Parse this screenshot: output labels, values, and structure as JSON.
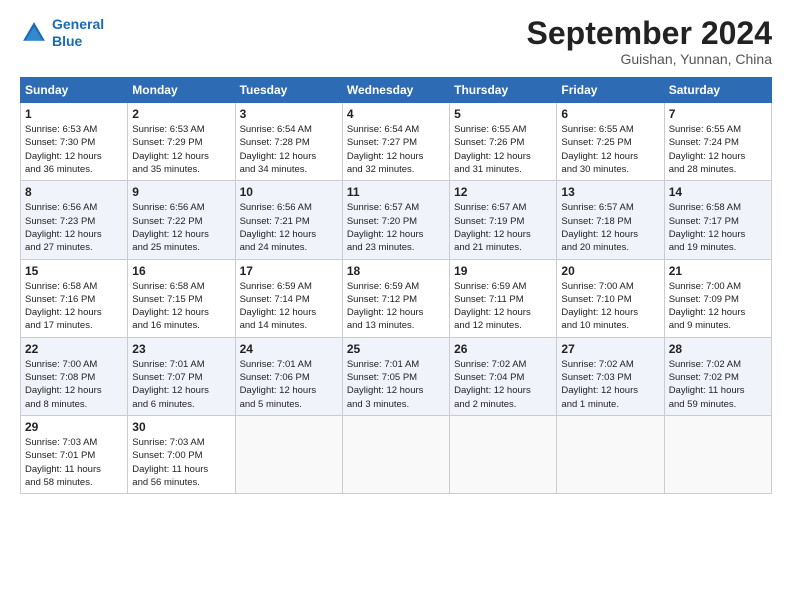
{
  "header": {
    "logo_line1": "General",
    "logo_line2": "Blue",
    "month_title": "September 2024",
    "location": "Guishan, Yunnan, China"
  },
  "weekdays": [
    "Sunday",
    "Monday",
    "Tuesday",
    "Wednesday",
    "Thursday",
    "Friday",
    "Saturday"
  ],
  "weeks": [
    [
      {
        "day": "1",
        "text": "Sunrise: 6:53 AM\nSunset: 7:30 PM\nDaylight: 12 hours\nand 36 minutes."
      },
      {
        "day": "2",
        "text": "Sunrise: 6:53 AM\nSunset: 7:29 PM\nDaylight: 12 hours\nand 35 minutes."
      },
      {
        "day": "3",
        "text": "Sunrise: 6:54 AM\nSunset: 7:28 PM\nDaylight: 12 hours\nand 34 minutes."
      },
      {
        "day": "4",
        "text": "Sunrise: 6:54 AM\nSunset: 7:27 PM\nDaylight: 12 hours\nand 32 minutes."
      },
      {
        "day": "5",
        "text": "Sunrise: 6:55 AM\nSunset: 7:26 PM\nDaylight: 12 hours\nand 31 minutes."
      },
      {
        "day": "6",
        "text": "Sunrise: 6:55 AM\nSunset: 7:25 PM\nDaylight: 12 hours\nand 30 minutes."
      },
      {
        "day": "7",
        "text": "Sunrise: 6:55 AM\nSunset: 7:24 PM\nDaylight: 12 hours\nand 28 minutes."
      }
    ],
    [
      {
        "day": "8",
        "text": "Sunrise: 6:56 AM\nSunset: 7:23 PM\nDaylight: 12 hours\nand 27 minutes."
      },
      {
        "day": "9",
        "text": "Sunrise: 6:56 AM\nSunset: 7:22 PM\nDaylight: 12 hours\nand 25 minutes."
      },
      {
        "day": "10",
        "text": "Sunrise: 6:56 AM\nSunset: 7:21 PM\nDaylight: 12 hours\nand 24 minutes."
      },
      {
        "day": "11",
        "text": "Sunrise: 6:57 AM\nSunset: 7:20 PM\nDaylight: 12 hours\nand 23 minutes."
      },
      {
        "day": "12",
        "text": "Sunrise: 6:57 AM\nSunset: 7:19 PM\nDaylight: 12 hours\nand 21 minutes."
      },
      {
        "day": "13",
        "text": "Sunrise: 6:57 AM\nSunset: 7:18 PM\nDaylight: 12 hours\nand 20 minutes."
      },
      {
        "day": "14",
        "text": "Sunrise: 6:58 AM\nSunset: 7:17 PM\nDaylight: 12 hours\nand 19 minutes."
      }
    ],
    [
      {
        "day": "15",
        "text": "Sunrise: 6:58 AM\nSunset: 7:16 PM\nDaylight: 12 hours\nand 17 minutes."
      },
      {
        "day": "16",
        "text": "Sunrise: 6:58 AM\nSunset: 7:15 PM\nDaylight: 12 hours\nand 16 minutes."
      },
      {
        "day": "17",
        "text": "Sunrise: 6:59 AM\nSunset: 7:14 PM\nDaylight: 12 hours\nand 14 minutes."
      },
      {
        "day": "18",
        "text": "Sunrise: 6:59 AM\nSunset: 7:12 PM\nDaylight: 12 hours\nand 13 minutes."
      },
      {
        "day": "19",
        "text": "Sunrise: 6:59 AM\nSunset: 7:11 PM\nDaylight: 12 hours\nand 12 minutes."
      },
      {
        "day": "20",
        "text": "Sunrise: 7:00 AM\nSunset: 7:10 PM\nDaylight: 12 hours\nand 10 minutes."
      },
      {
        "day": "21",
        "text": "Sunrise: 7:00 AM\nSunset: 7:09 PM\nDaylight: 12 hours\nand 9 minutes."
      }
    ],
    [
      {
        "day": "22",
        "text": "Sunrise: 7:00 AM\nSunset: 7:08 PM\nDaylight: 12 hours\nand 8 minutes."
      },
      {
        "day": "23",
        "text": "Sunrise: 7:01 AM\nSunset: 7:07 PM\nDaylight: 12 hours\nand 6 minutes."
      },
      {
        "day": "24",
        "text": "Sunrise: 7:01 AM\nSunset: 7:06 PM\nDaylight: 12 hours\nand 5 minutes."
      },
      {
        "day": "25",
        "text": "Sunrise: 7:01 AM\nSunset: 7:05 PM\nDaylight: 12 hours\nand 3 minutes."
      },
      {
        "day": "26",
        "text": "Sunrise: 7:02 AM\nSunset: 7:04 PM\nDaylight: 12 hours\nand 2 minutes."
      },
      {
        "day": "27",
        "text": "Sunrise: 7:02 AM\nSunset: 7:03 PM\nDaylight: 12 hours\nand 1 minute."
      },
      {
        "day": "28",
        "text": "Sunrise: 7:02 AM\nSunset: 7:02 PM\nDaylight: 11 hours\nand 59 minutes."
      }
    ],
    [
      {
        "day": "29",
        "text": "Sunrise: 7:03 AM\nSunset: 7:01 PM\nDaylight: 11 hours\nand 58 minutes."
      },
      {
        "day": "30",
        "text": "Sunrise: 7:03 AM\nSunset: 7:00 PM\nDaylight: 11 hours\nand 56 minutes."
      },
      {
        "day": "",
        "text": ""
      },
      {
        "day": "",
        "text": ""
      },
      {
        "day": "",
        "text": ""
      },
      {
        "day": "",
        "text": ""
      },
      {
        "day": "",
        "text": ""
      }
    ]
  ]
}
